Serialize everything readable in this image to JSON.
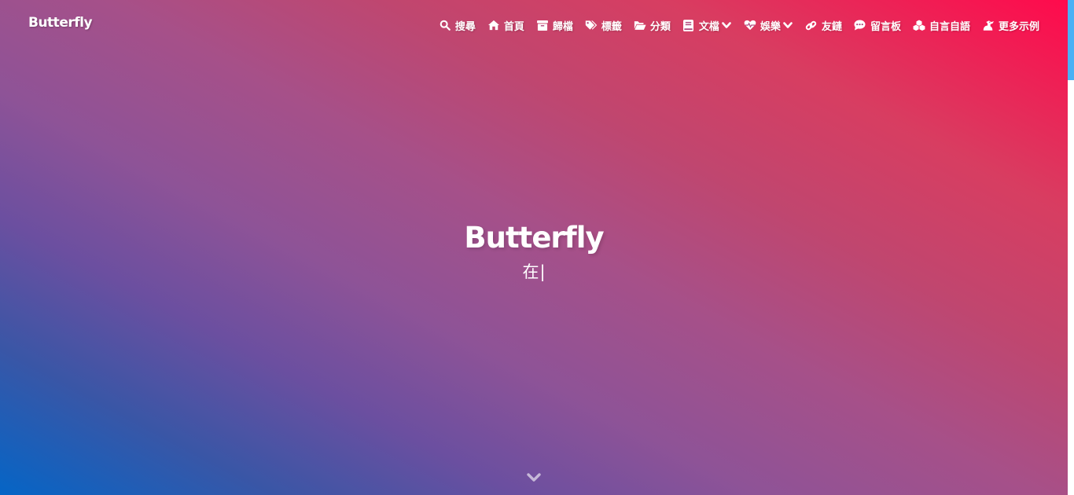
{
  "header": {
    "site_name": "Butterfly"
  },
  "menu": {
    "items": [
      {
        "label": "搜尋",
        "icon": "search-icon"
      },
      {
        "label": "首頁",
        "icon": "home-icon"
      },
      {
        "label": "歸檔",
        "icon": "archive-icon"
      },
      {
        "label": "標籤",
        "icon": "tags-icon"
      },
      {
        "label": "分類",
        "icon": "folder-open-icon"
      },
      {
        "label": "文檔",
        "icon": "book-icon",
        "dropdown": true
      },
      {
        "label": "娛樂",
        "icon": "heartbeat-icon",
        "dropdown": true
      },
      {
        "label": "友鏈",
        "icon": "link-icon"
      },
      {
        "label": "留言板",
        "icon": "comment-dots-icon"
      },
      {
        "label": "自言自語",
        "icon": "cubes-icon"
      },
      {
        "label": "更多示例",
        "icon": "dragon-icon"
      }
    ]
  },
  "hero": {
    "title": "Butterfly",
    "subtitle": "在",
    "cursor": "|",
    "scroll_icon": "chevron-down-icon"
  },
  "colors": {
    "gradient_start": "#0565c6",
    "gradient_mid": "#a65089",
    "gradient_end": "#ff0a4c",
    "scrollbar_thumb": "#49b1f5",
    "text": "#ffffff"
  }
}
